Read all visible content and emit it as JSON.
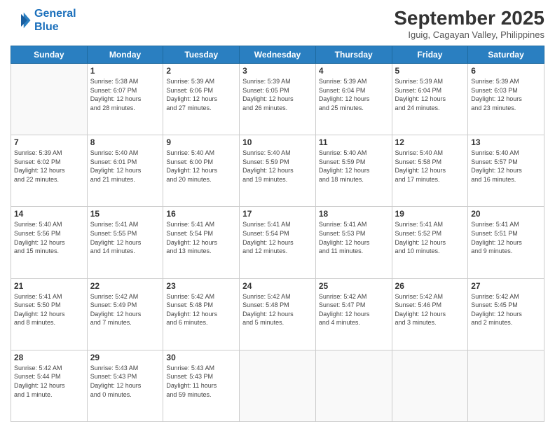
{
  "header": {
    "logo_line1": "General",
    "logo_line2": "Blue",
    "month_title": "September 2025",
    "location": "Iguig, Cagayan Valley, Philippines"
  },
  "weekdays": [
    "Sunday",
    "Monday",
    "Tuesday",
    "Wednesday",
    "Thursday",
    "Friday",
    "Saturday"
  ],
  "weeks": [
    [
      {
        "day": "",
        "info": ""
      },
      {
        "day": "1",
        "info": "Sunrise: 5:38 AM\nSunset: 6:07 PM\nDaylight: 12 hours\nand 28 minutes."
      },
      {
        "day": "2",
        "info": "Sunrise: 5:39 AM\nSunset: 6:06 PM\nDaylight: 12 hours\nand 27 minutes."
      },
      {
        "day": "3",
        "info": "Sunrise: 5:39 AM\nSunset: 6:05 PM\nDaylight: 12 hours\nand 26 minutes."
      },
      {
        "day": "4",
        "info": "Sunrise: 5:39 AM\nSunset: 6:04 PM\nDaylight: 12 hours\nand 25 minutes."
      },
      {
        "day": "5",
        "info": "Sunrise: 5:39 AM\nSunset: 6:04 PM\nDaylight: 12 hours\nand 24 minutes."
      },
      {
        "day": "6",
        "info": "Sunrise: 5:39 AM\nSunset: 6:03 PM\nDaylight: 12 hours\nand 23 minutes."
      }
    ],
    [
      {
        "day": "7",
        "info": "Sunrise: 5:39 AM\nSunset: 6:02 PM\nDaylight: 12 hours\nand 22 minutes."
      },
      {
        "day": "8",
        "info": "Sunrise: 5:40 AM\nSunset: 6:01 PM\nDaylight: 12 hours\nand 21 minutes."
      },
      {
        "day": "9",
        "info": "Sunrise: 5:40 AM\nSunset: 6:00 PM\nDaylight: 12 hours\nand 20 minutes."
      },
      {
        "day": "10",
        "info": "Sunrise: 5:40 AM\nSunset: 5:59 PM\nDaylight: 12 hours\nand 19 minutes."
      },
      {
        "day": "11",
        "info": "Sunrise: 5:40 AM\nSunset: 5:59 PM\nDaylight: 12 hours\nand 18 minutes."
      },
      {
        "day": "12",
        "info": "Sunrise: 5:40 AM\nSunset: 5:58 PM\nDaylight: 12 hours\nand 17 minutes."
      },
      {
        "day": "13",
        "info": "Sunrise: 5:40 AM\nSunset: 5:57 PM\nDaylight: 12 hours\nand 16 minutes."
      }
    ],
    [
      {
        "day": "14",
        "info": "Sunrise: 5:40 AM\nSunset: 5:56 PM\nDaylight: 12 hours\nand 15 minutes."
      },
      {
        "day": "15",
        "info": "Sunrise: 5:41 AM\nSunset: 5:55 PM\nDaylight: 12 hours\nand 14 minutes."
      },
      {
        "day": "16",
        "info": "Sunrise: 5:41 AM\nSunset: 5:54 PM\nDaylight: 12 hours\nand 13 minutes."
      },
      {
        "day": "17",
        "info": "Sunrise: 5:41 AM\nSunset: 5:54 PM\nDaylight: 12 hours\nand 12 minutes."
      },
      {
        "day": "18",
        "info": "Sunrise: 5:41 AM\nSunset: 5:53 PM\nDaylight: 12 hours\nand 11 minutes."
      },
      {
        "day": "19",
        "info": "Sunrise: 5:41 AM\nSunset: 5:52 PM\nDaylight: 12 hours\nand 10 minutes."
      },
      {
        "day": "20",
        "info": "Sunrise: 5:41 AM\nSunset: 5:51 PM\nDaylight: 12 hours\nand 9 minutes."
      }
    ],
    [
      {
        "day": "21",
        "info": "Sunrise: 5:41 AM\nSunset: 5:50 PM\nDaylight: 12 hours\nand 8 minutes."
      },
      {
        "day": "22",
        "info": "Sunrise: 5:42 AM\nSunset: 5:49 PM\nDaylight: 12 hours\nand 7 minutes."
      },
      {
        "day": "23",
        "info": "Sunrise: 5:42 AM\nSunset: 5:48 PM\nDaylight: 12 hours\nand 6 minutes."
      },
      {
        "day": "24",
        "info": "Sunrise: 5:42 AM\nSunset: 5:48 PM\nDaylight: 12 hours\nand 5 minutes."
      },
      {
        "day": "25",
        "info": "Sunrise: 5:42 AM\nSunset: 5:47 PM\nDaylight: 12 hours\nand 4 minutes."
      },
      {
        "day": "26",
        "info": "Sunrise: 5:42 AM\nSunset: 5:46 PM\nDaylight: 12 hours\nand 3 minutes."
      },
      {
        "day": "27",
        "info": "Sunrise: 5:42 AM\nSunset: 5:45 PM\nDaylight: 12 hours\nand 2 minutes."
      }
    ],
    [
      {
        "day": "28",
        "info": "Sunrise: 5:42 AM\nSunset: 5:44 PM\nDaylight: 12 hours\nand 1 minute."
      },
      {
        "day": "29",
        "info": "Sunrise: 5:43 AM\nSunset: 5:43 PM\nDaylight: 12 hours\nand 0 minutes."
      },
      {
        "day": "30",
        "info": "Sunrise: 5:43 AM\nSunset: 5:43 PM\nDaylight: 11 hours\nand 59 minutes."
      },
      {
        "day": "",
        "info": ""
      },
      {
        "day": "",
        "info": ""
      },
      {
        "day": "",
        "info": ""
      },
      {
        "day": "",
        "info": ""
      }
    ]
  ]
}
